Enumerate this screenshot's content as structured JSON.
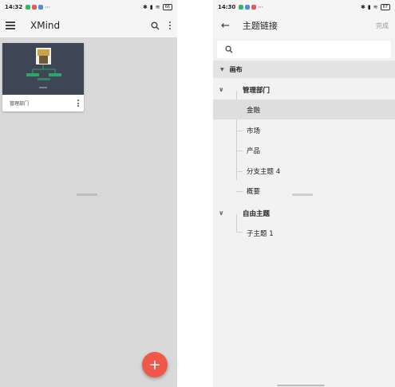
{
  "left_screen": {
    "status_bar": {
      "time": "14:32",
      "battery": "66"
    },
    "app_title": "XMind",
    "document": {
      "name": "管理部门"
    },
    "fab_label": "+"
  },
  "right_screen": {
    "status_bar": {
      "time": "14:30",
      "battery": "67"
    },
    "title": "主题链接",
    "done_label": "完成",
    "search": {
      "value": "",
      "placeholder": ""
    },
    "canvas_label": "画布",
    "topics": [
      {
        "label": "管理部门",
        "children": [
          "金融",
          "市场",
          "产品",
          "分支主题 4",
          "概要"
        ]
      },
      {
        "label": "自由主题",
        "children": [
          "子主题 1"
        ]
      }
    ],
    "selected_topic": "金融"
  },
  "colors": {
    "accent_fab": "#f0584a",
    "thumb_bg": "#3e4554",
    "selection_bg": "#dedede"
  }
}
